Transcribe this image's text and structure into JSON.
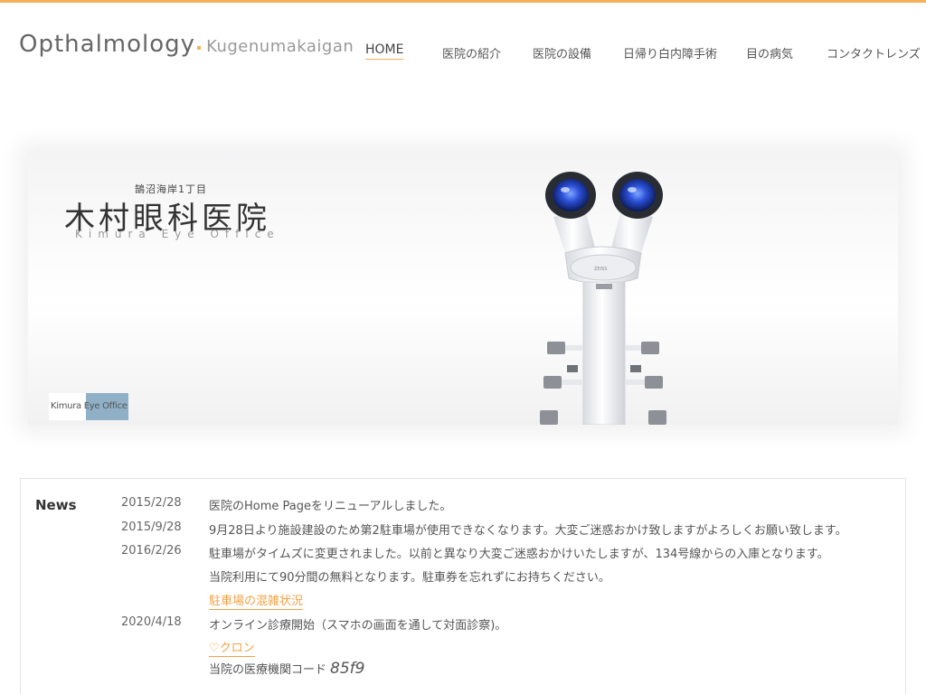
{
  "header": {
    "brand_main": "Opthalmology",
    "brand_sub": "Kugenumakaigan",
    "accent_color": "#f4b15a"
  },
  "nav": {
    "items": [
      {
        "label": "HOME",
        "active": true
      },
      {
        "label": "医院の紹介"
      },
      {
        "label": "医院の設備"
      },
      {
        "label": "日帰り白内障手術"
      },
      {
        "label": "目の病気"
      },
      {
        "label": "コンタクトレンズ"
      }
    ]
  },
  "hero": {
    "address": "鵠沼海岸1丁目",
    "title": "木村眼科医院",
    "subtitle": "Kimura Eye Office",
    "badge": "Kimura Eye Office",
    "badge_color": "#8fb0c6"
  },
  "news": {
    "heading": "News",
    "entries": [
      {
        "date": "2015/2/28",
        "text": "医院のHome Pageをリニューアルしました。"
      },
      {
        "date": "2015/9/28",
        "text": "9月28日より施設建設のため第2駐車場が使用できなくなります。大変ご迷惑おかけ致しますがよろしくお願い致します。"
      },
      {
        "date": "2016/2/26",
        "text": "駐車場がタイムズに変更されました。以前と異なり大変ご迷惑おかけいたしますが、134号線からの入庫となります。",
        "text2": "当院利用にて90分間の無料となります。駐車券を忘れずにお持ちください。",
        "link": "駐車場の混雑状況"
      },
      {
        "date": "2020/4/18",
        "text": "オンライン診療開始（スマホの画面を通して対面診察)。",
        "link": "♡クロン",
        "code_label": "当院の医療機関コード",
        "code_value": "85f9"
      }
    ],
    "link_color": "#f0a246"
  }
}
